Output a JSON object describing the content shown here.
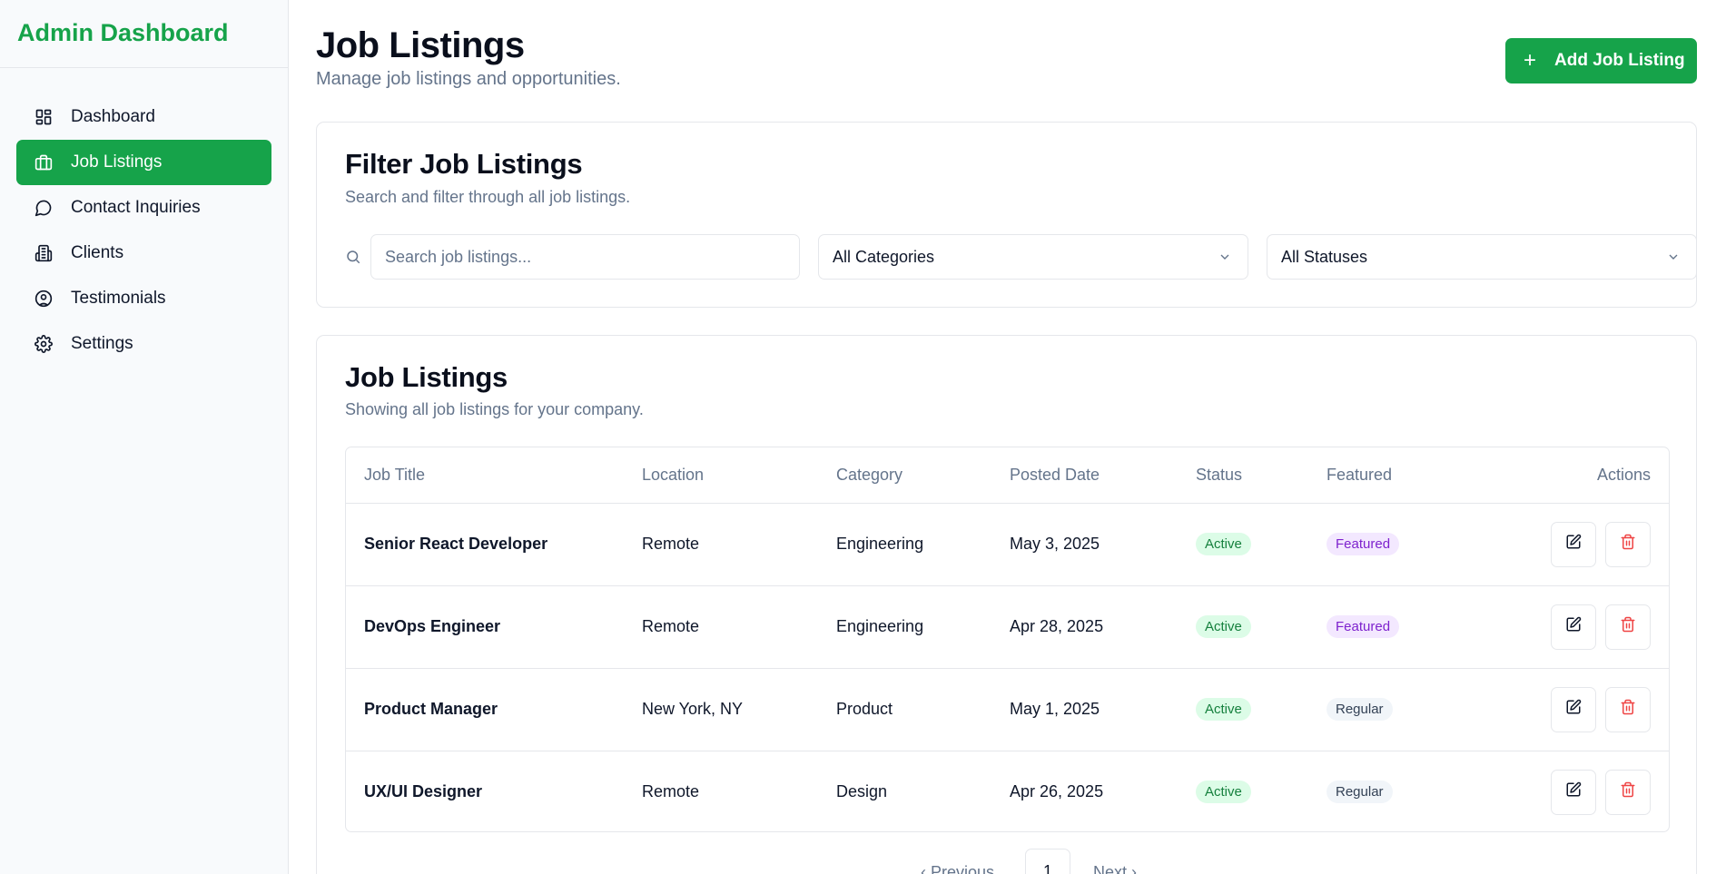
{
  "app": {
    "brand": "Admin Dashboard",
    "accent_color": "#16a34a"
  },
  "sidebar": {
    "items": [
      {
        "label": "Dashboard",
        "icon": "dashboard-icon",
        "active": false
      },
      {
        "label": "Job Listings",
        "icon": "briefcase-icon",
        "active": true
      },
      {
        "label": "Contact Inquiries",
        "icon": "message-circle-icon",
        "active": false
      },
      {
        "label": "Clients",
        "icon": "building-icon",
        "active": false
      },
      {
        "label": "Testimonials",
        "icon": "user-circle-icon",
        "active": false
      },
      {
        "label": "Settings",
        "icon": "gear-icon",
        "active": false
      }
    ]
  },
  "header": {
    "title": "Job Listings",
    "subtitle": "Manage job listings and opportunities.",
    "add_button": "Add Job Listing"
  },
  "filter": {
    "title": "Filter Job Listings",
    "subtitle": "Search and filter through all job listings.",
    "search_placeholder": "Search job listings...",
    "category_value": "All Categories",
    "status_value": "All Statuses"
  },
  "listing": {
    "title": "Job Listings",
    "subtitle": "Showing all job listings for your company.",
    "columns": [
      "Job Title",
      "Location",
      "Category",
      "Posted Date",
      "Status",
      "Featured",
      "Actions"
    ],
    "rows": [
      {
        "title": "Senior React Developer",
        "location": "Remote",
        "category": "Engineering",
        "date": "May 3, 2025",
        "status": "Active",
        "featured": "Featured"
      },
      {
        "title": "DevOps Engineer",
        "location": "Remote",
        "category": "Engineering",
        "date": "Apr 28, 2025",
        "status": "Active",
        "featured": "Featured"
      },
      {
        "title": "Product Manager",
        "location": "New York, NY",
        "category": "Product",
        "date": "May 1, 2025",
        "status": "Active",
        "featured": "Regular"
      },
      {
        "title": "UX/UI Designer",
        "location": "Remote",
        "category": "Design",
        "date": "Apr 26, 2025",
        "status": "Active",
        "featured": "Regular"
      }
    ]
  },
  "pagination": {
    "prev": "Previous",
    "current": "1",
    "next": "Next"
  }
}
